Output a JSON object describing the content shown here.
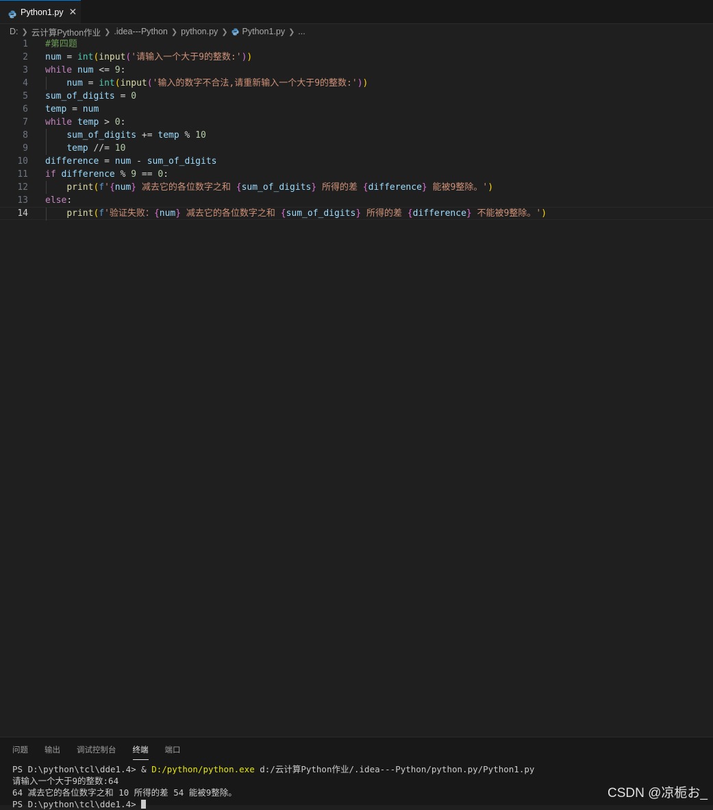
{
  "tab": {
    "title": "Python1.py",
    "close": "✕"
  },
  "breadcrumb": [
    "D:",
    "云计算Python作业",
    ".idea---Python",
    "python.py",
    "Python1.py",
    "..."
  ],
  "editor": {
    "current_line": 14,
    "lines": [
      "#第四题",
      "num = int(input('请输入一个大于9的整数:'))",
      "while num <= 9:",
      "    num = int(input('输入的数字不合法,请重新输入一个大于9的整数:'))",
      "sum_of_digits = 0",
      "temp = num",
      "while temp > 0:",
      "    sum_of_digits += temp % 10",
      "    temp //= 10",
      "difference = num - sum_of_digits",
      "if difference % 9 == 0:",
      "    print(f'{num} 减去它的各位数字之和 {sum_of_digits} 所得的差 {difference} 能被9整除。')",
      "else:",
      "    print(f'验证失败：{num} 减去它的各位数字之和 {sum_of_digits} 所得的差 {difference} 不能被9整除。')"
    ]
  },
  "panel": {
    "tabs": [
      "问题",
      "输出",
      "调试控制台",
      "终端",
      "端口"
    ],
    "active_tab": "终端",
    "terminal": {
      "prompt1": "PS D:\\python\\tcl\\dde1.4> & ",
      "exe_path": "D:/python/python.exe",
      "script_arg": " d:/云计算Python作业/.idea---Python/python.py/Python1.py",
      "line2": "请输入一个大于9的整数:64",
      "line3": "64 减去它的各位数字之和 10 所得的差 54 能被9整除。",
      "prompt2": "PS D:\\python\\tcl\\dde1.4> "
    }
  },
  "watermark": "CSDN @凉栀お_",
  "colors": {
    "accent": "#0078d4",
    "keyword": "#c586c0",
    "variable": "#9cdcfe",
    "function": "#dcdcaa",
    "string": "#ce9178",
    "number": "#b5cea8",
    "comment": "#6a9955",
    "class": "#4ec9b0"
  }
}
